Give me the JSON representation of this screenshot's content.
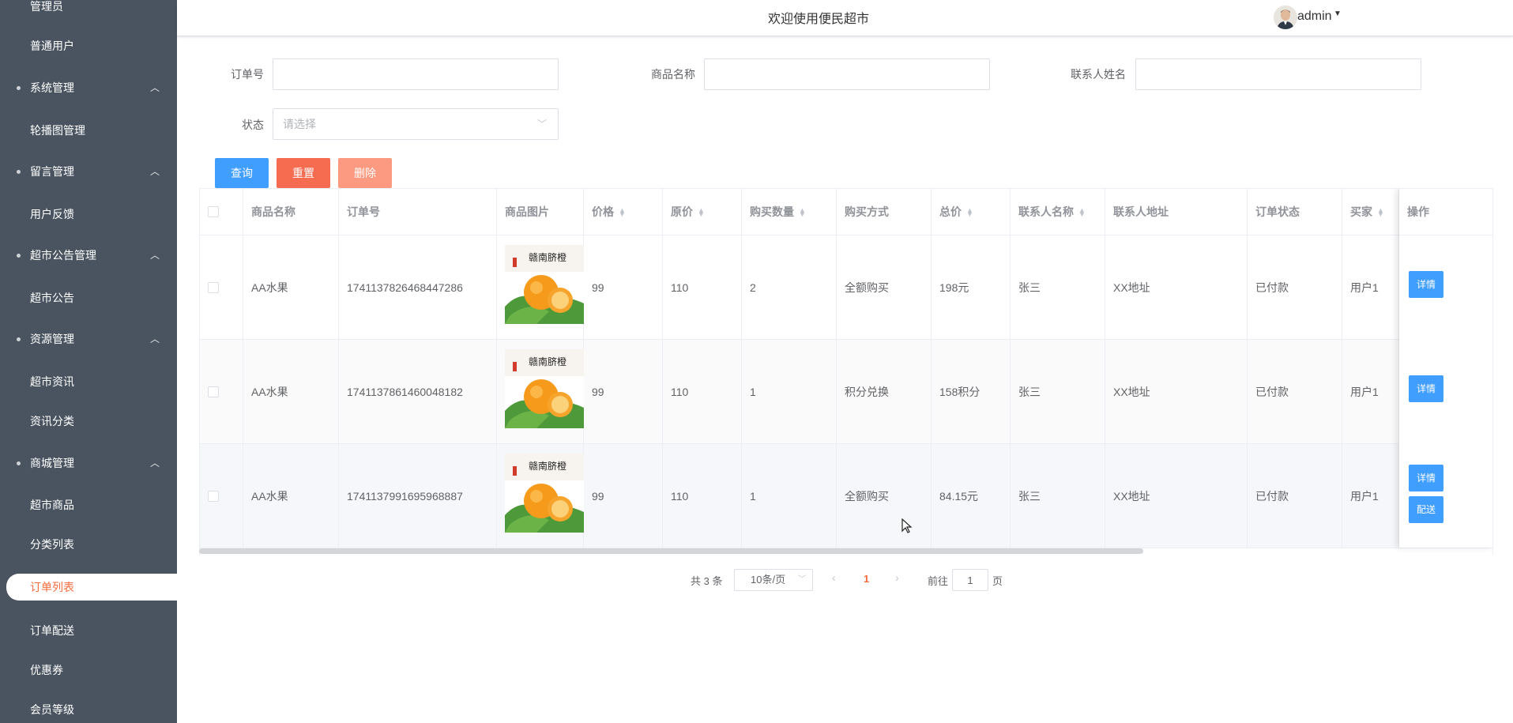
{
  "header": {
    "title": "欢迎使用便民超市",
    "user": "admin"
  },
  "sidebar": {
    "items": [
      {
        "label": "管理员"
      },
      {
        "label": "普通用户"
      },
      {
        "label": "系统管理"
      },
      {
        "label": "轮播图管理"
      },
      {
        "label": "留言管理"
      },
      {
        "label": "用户反馈"
      },
      {
        "label": "超市公告管理"
      },
      {
        "label": "超市公告"
      },
      {
        "label": "资源管理"
      },
      {
        "label": "超市资讯"
      },
      {
        "label": "资讯分类"
      },
      {
        "label": "商城管理"
      },
      {
        "label": "超市商品"
      },
      {
        "label": "分类列表"
      },
      {
        "label": "订单列表"
      },
      {
        "label": "订单配送"
      },
      {
        "label": "优惠券"
      },
      {
        "label": "会员等级"
      }
    ]
  },
  "search": {
    "order_no_label": "订单号",
    "order_no_value": "",
    "product_name_label": "商品名称",
    "product_name_value": "",
    "contact_label": "联系人姓名",
    "contact_value": "",
    "status_label": "状态",
    "status_placeholder": "请选择"
  },
  "buttons": {
    "query": "查询",
    "reset": "重置",
    "delete": "删除"
  },
  "table": {
    "columns": [
      "商品名称",
      "订单号",
      "商品图片",
      "价格",
      "原价",
      "购买数量",
      "购买方式",
      "总价",
      "联系人名称",
      "联系人地址",
      "订单状态",
      "买家",
      "操作"
    ],
    "image_text": "赣南脐橙",
    "detail_label": "详情",
    "deliver_label": "配送",
    "rows": [
      {
        "product": "AA水果",
        "order_no": "1741137826468447286",
        "price": "99",
        "original_price": "110",
        "quantity": "2",
        "method": "全额购买",
        "total": "198元",
        "contact": "张三",
        "address": "XX地址",
        "status": "已付款",
        "buyer": "用户1"
      },
      {
        "product": "AA水果",
        "order_no": "1741137861460048182",
        "price": "99",
        "original_price": "110",
        "quantity": "1",
        "method": "积分兑换",
        "total": "158积分",
        "contact": "张三",
        "address": "XX地址",
        "status": "已付款",
        "buyer": "用户1"
      },
      {
        "product": "AA水果",
        "order_no": "1741137991695968887",
        "price": "99",
        "original_price": "110",
        "quantity": "1",
        "method": "全额购买",
        "total": "84.15元",
        "contact": "张三",
        "address": "XX地址",
        "status": "已付款",
        "buyer": "用户1"
      }
    ]
  },
  "pagination": {
    "total": "共 3 条",
    "page_size": "10条/页",
    "current_page": "1",
    "goto_label": "前往",
    "goto_value": "1",
    "page_suffix": "页"
  },
  "colors": {
    "sidebar_bg": "#4a5460",
    "primary": "#409eff",
    "danger": "#f56c51",
    "active": "#f56c3c"
  }
}
